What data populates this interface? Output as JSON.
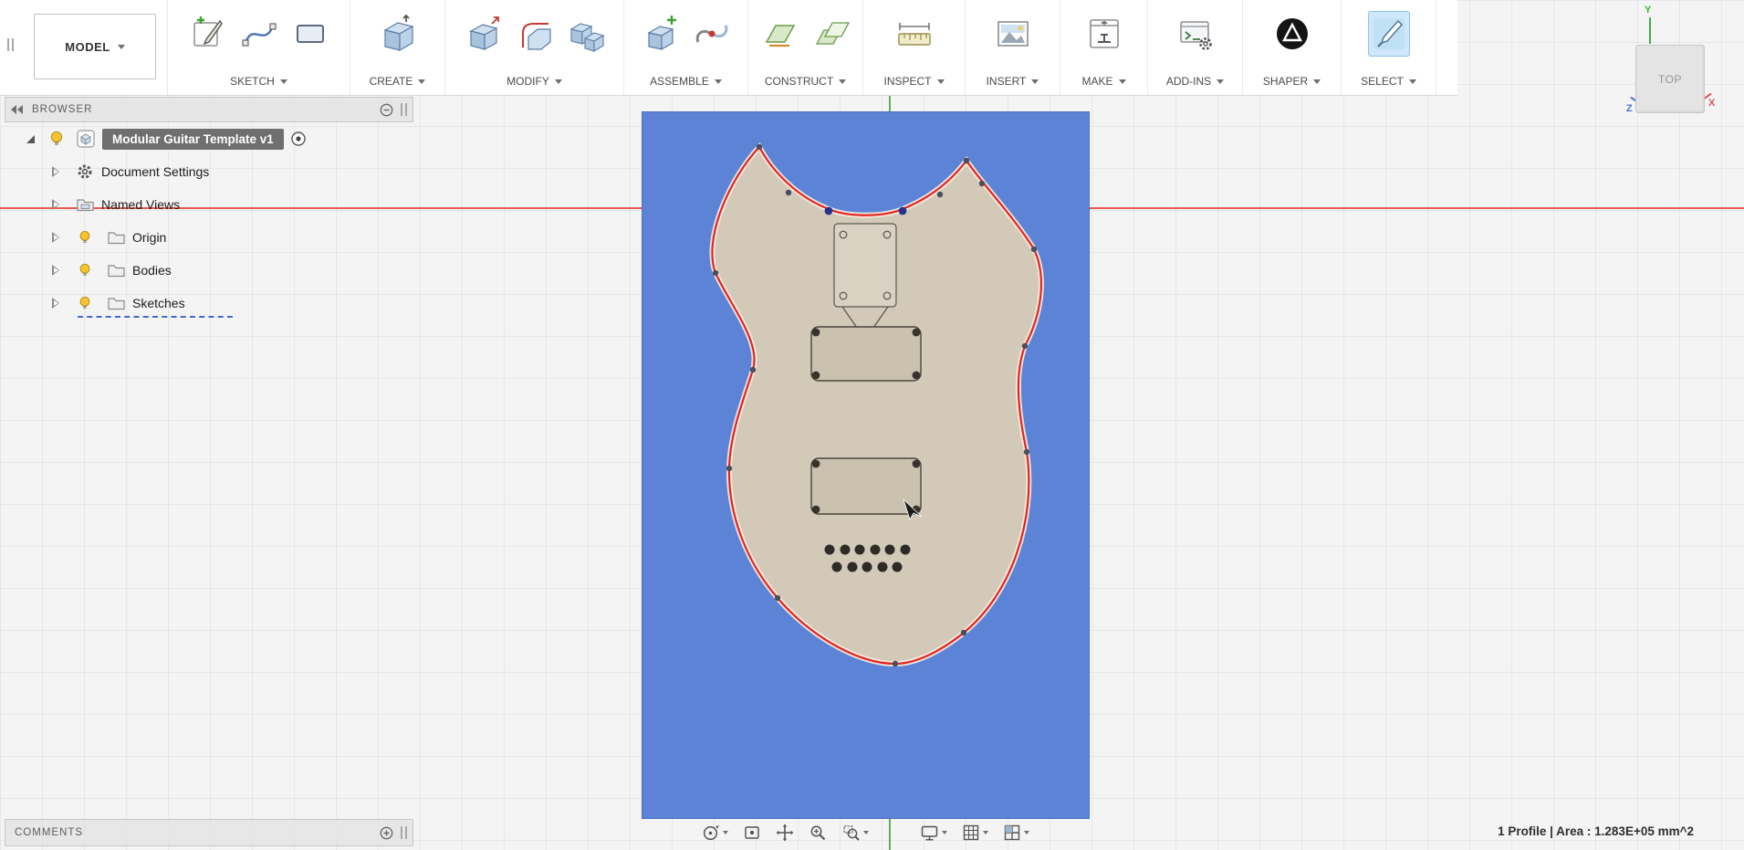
{
  "toolbar": {
    "workspace": "MODEL",
    "groups": [
      {
        "label": "SKETCH",
        "icons": [
          "create-sketch-icon",
          "spline-icon",
          "rectangle-icon"
        ]
      },
      {
        "label": "CREATE",
        "icons": [
          "extrude-icon"
        ]
      },
      {
        "label": "MODIFY",
        "icons": [
          "press-pull-icon",
          "fillet-icon",
          "combine-icon"
        ]
      },
      {
        "label": "ASSEMBLE",
        "icons": [
          "new-component-icon",
          "joint-icon"
        ]
      },
      {
        "label": "CONSTRUCT",
        "icons": [
          "plane-offset-icon",
          "plane-angle-icon"
        ]
      },
      {
        "label": "INSPECT",
        "icons": [
          "measure-icon"
        ]
      },
      {
        "label": "INSERT",
        "icons": [
          "insert-image-icon"
        ]
      },
      {
        "label": "MAKE",
        "icons": [
          "3d-print-icon"
        ]
      },
      {
        "label": "ADD-INS",
        "icons": [
          "scripts-addins-icon"
        ]
      },
      {
        "label": "SHAPER",
        "icons": [
          "shaper-utilities-icon"
        ]
      },
      {
        "label": "SELECT",
        "icons": [
          "select-icon"
        ]
      }
    ]
  },
  "browser": {
    "header": "BROWSER",
    "root": {
      "label": "Modular Guitar Template v1"
    },
    "items": [
      {
        "label": "Document Settings",
        "icon": "gear-icon"
      },
      {
        "label": "Named Views",
        "icon": "folder-icon"
      },
      {
        "label": "Origin",
        "icon": "folder-icon",
        "visibility": "bulb-icon"
      },
      {
        "label": "Bodies",
        "icon": "folder-icon",
        "visibility": "bulb-icon"
      },
      {
        "label": "Sketches",
        "icon": "folder-icon",
        "visibility": "bulb-icon"
      }
    ]
  },
  "comments": {
    "label": "COMMENTS"
  },
  "viewcube": {
    "face": "TOP",
    "axes": {
      "x": "X",
      "y": "Y",
      "z": "Z"
    }
  },
  "navbar": {
    "icons": [
      "orbit-icon",
      "look-at-icon",
      "pan-icon",
      "zoom-icon",
      "zoom-window-icon",
      "display-settings-icon",
      "grid-display-icon",
      "viewports-icon"
    ]
  },
  "statusbar": {
    "selection_info": "1 Profile | Area : 1.283E+05 mm^2"
  },
  "colors": {
    "sketch_plane": "#5d83d6",
    "profile_highlight_red": "#e8241f",
    "guitar_body": "#d2c9b8",
    "cavity_fill": "#cac1af",
    "axis_x_red": "#e8473f",
    "axis_y_green": "#4a9e3f",
    "selected_row_bg": "#6f6f6f"
  }
}
